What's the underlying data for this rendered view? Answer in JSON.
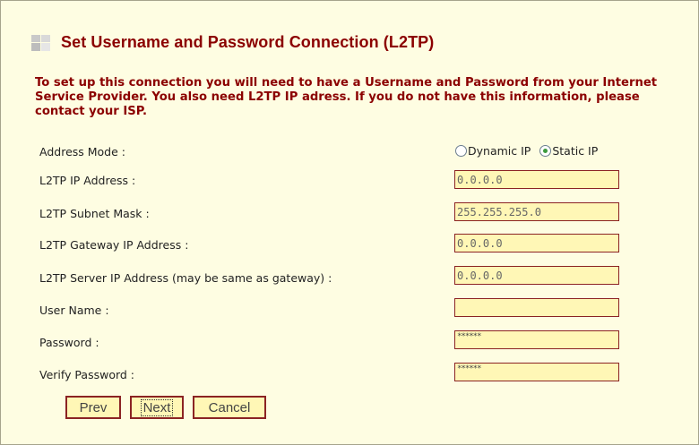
{
  "header": {
    "title": "Set Username and Password Connection (L2TP)",
    "intro": "To set up this connection you will need to have a Username and Password from your Internet Service Provider. You also need L2TP IP adress. If you do not have this information, please contact your ISP."
  },
  "form": {
    "address_mode": {
      "label": "Address Mode :",
      "options": [
        "Dynamic IP",
        "Static IP"
      ],
      "selected": "Static IP"
    },
    "l2tp_ip": {
      "label": "L2TP IP Address :",
      "value": "0.0.0.0"
    },
    "l2tp_subnet": {
      "label": "L2TP Subnet Mask :",
      "value": "255.255.255.0"
    },
    "l2tp_gateway": {
      "label": "L2TP Gateway IP Address :",
      "value": "0.0.0.0"
    },
    "l2tp_server": {
      "label": "L2TP Server IP Address (may be same as gateway) :",
      "value": "0.0.0.0"
    },
    "username": {
      "label": "User Name :",
      "value": ""
    },
    "password": {
      "label": "Password :",
      "value": "******"
    },
    "verify_password": {
      "label": "Verify Password :",
      "value": "******"
    }
  },
  "buttons": {
    "prev": "Prev",
    "next": "Next",
    "cancel": "Cancel"
  },
  "colors": {
    "accent": "#8b0000",
    "field_bg": "#fff7b6",
    "panel_bg": "#fefde2"
  },
  "icons": {
    "title": "section-grid-icon"
  }
}
